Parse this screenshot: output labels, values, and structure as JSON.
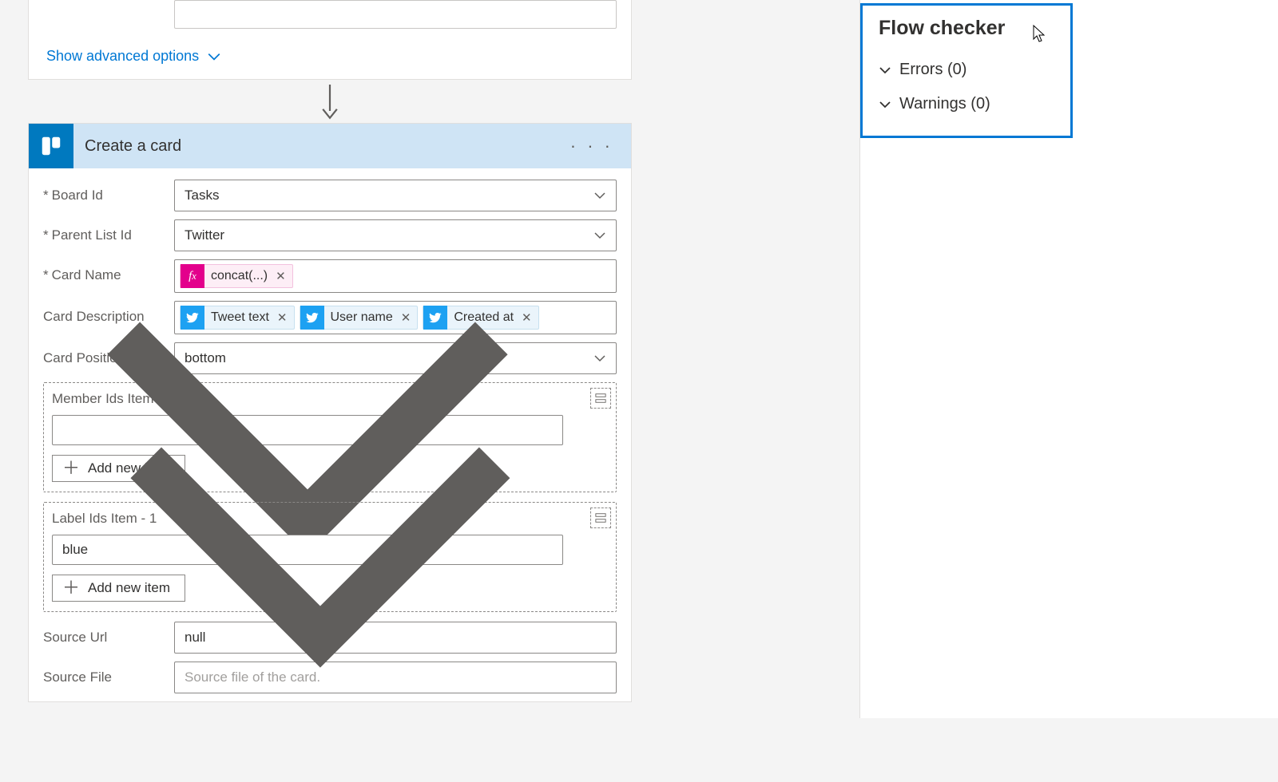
{
  "advanced_label": "Show advanced options",
  "action": {
    "title": "Create a card",
    "fields": {
      "board_label": "Board Id",
      "board_value": "Tasks",
      "parent_label": "Parent List Id",
      "parent_value": "Twitter",
      "cardname_label": "Card Name",
      "cardname_token": "concat(...)",
      "desc_label": "Card Description",
      "desc_tokens": [
        "Tweet text",
        "User name",
        "Created at"
      ],
      "position_label": "Card Position",
      "position_value": "bottom",
      "member_title": "Member Ids Item - 1",
      "member_value": "",
      "label_title": "Label Ids Item - 1",
      "label_value": "blue",
      "add_item": "Add new item",
      "source_url_label": "Source Url",
      "source_url_value": "null",
      "source_file_label": "Source File",
      "source_file_placeholder": "Source file of the card."
    }
  },
  "checker": {
    "title": "Flow checker",
    "errors": "Errors (0)",
    "warnings": "Warnings (0)"
  }
}
